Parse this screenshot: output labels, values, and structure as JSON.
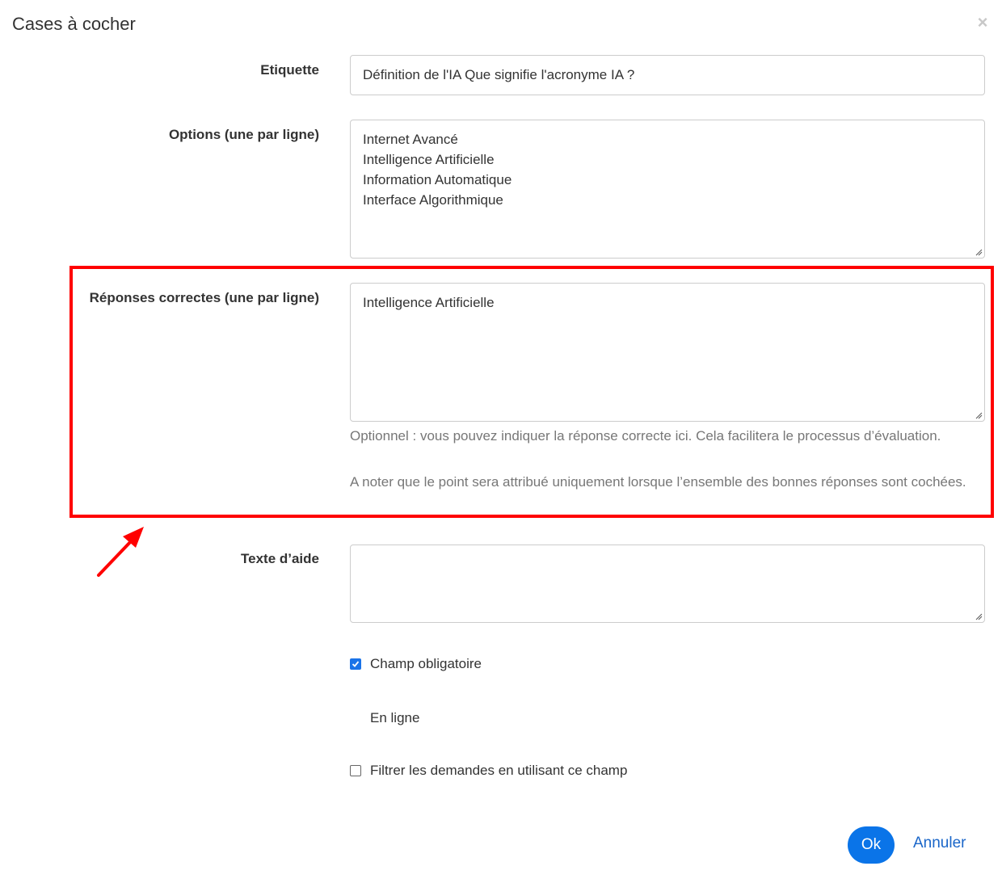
{
  "dialog": {
    "title": "Cases à cocher",
    "close_icon": "close-icon",
    "close_symbol": "×"
  },
  "fields": {
    "label": {
      "label": "Etiquette",
      "value": "Définition de l'IA Que signifie l'acronyme IA ?"
    },
    "options": {
      "label": "Options (une par ligne)",
      "lines": [
        "Internet Avancé",
        "Intelligence Artificielle",
        "Information Automatique",
        "Interface Algorithmique"
      ]
    },
    "correct_answers": {
      "label": "Réponses correctes (une par ligne)",
      "lines": [
        "Intelligence Artificielle"
      ],
      "help_1": "Optionnel : vous pouvez indiquer la réponse correcte ici. Cela facilitera le processus d’évaluation.",
      "help_2": "A noter que le point sera attribué uniquement lorsque l’ensemble des bonnes réponses sont cochées."
    },
    "help_text": {
      "label": "Texte d’aide",
      "value": ""
    }
  },
  "checkboxes": {
    "required": {
      "label": "Champ obligatoire",
      "checked": true
    },
    "inline_label": "En ligne",
    "filter": {
      "label": "Filtrer les demandes en utilisant ce champ",
      "checked": false
    }
  },
  "buttons": {
    "ok": "Ok",
    "cancel": "Annuler"
  },
  "colors": {
    "highlight": "#ff0000",
    "primary": "#0a74e8",
    "link": "#1a66c9"
  }
}
